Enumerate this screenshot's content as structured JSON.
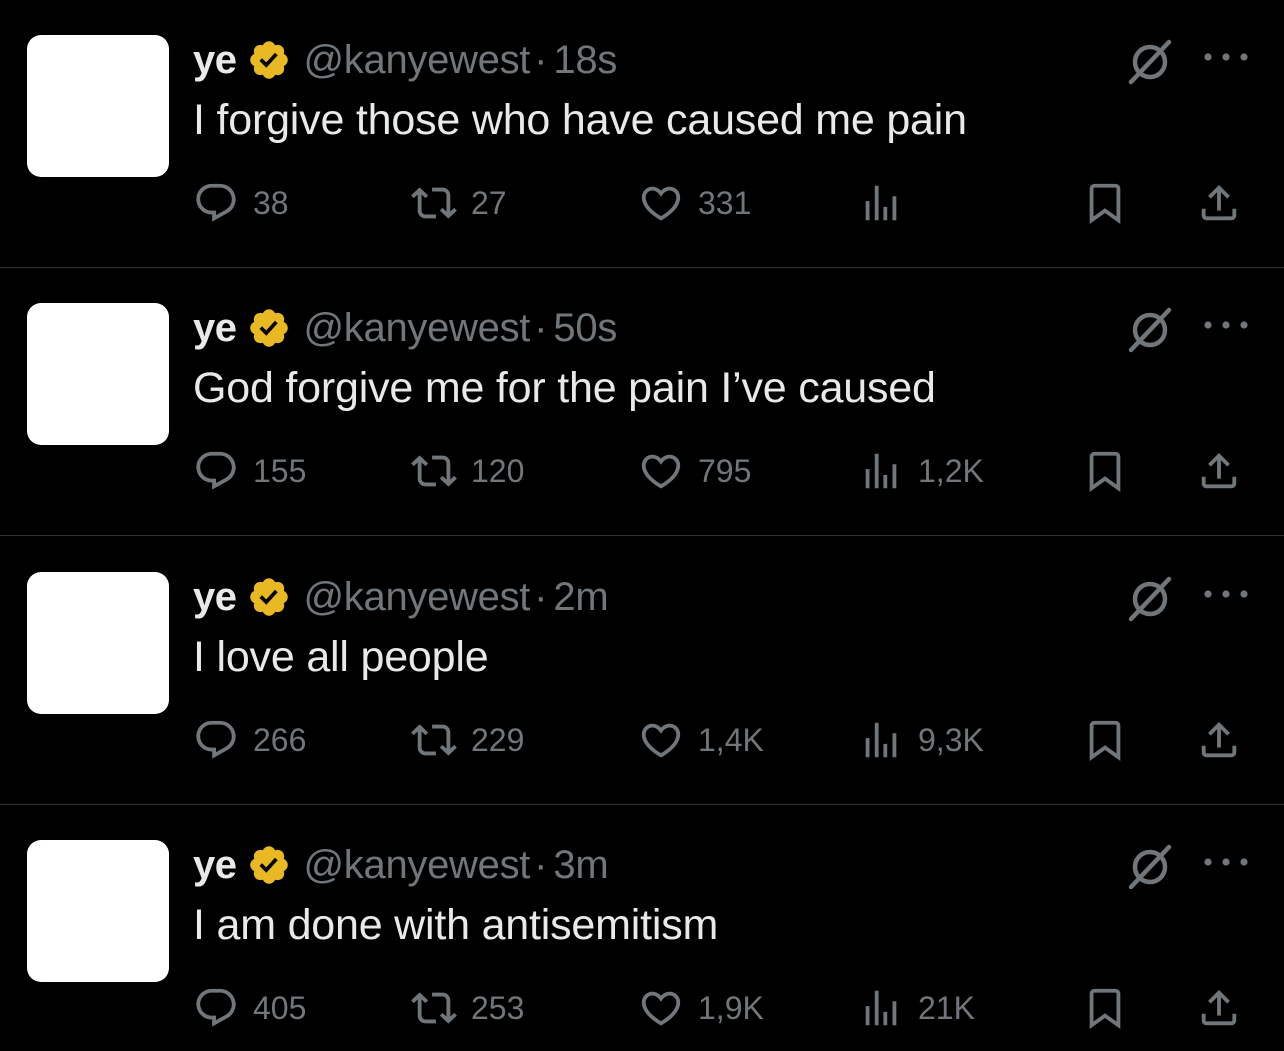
{
  "tweets": [
    {
      "name": "ye",
      "handle": "@kanyewest",
      "separator": "·",
      "time": "18s",
      "text": "I forgive those who have caused me pain",
      "replies": "38",
      "retweets": "27",
      "likes": "331",
      "views": ""
    },
    {
      "name": "ye",
      "handle": "@kanyewest",
      "separator": "·",
      "time": "50s",
      "text": "God forgive me for the pain I’ve caused",
      "replies": "155",
      "retweets": "120",
      "likes": "795",
      "views": "1,2K"
    },
    {
      "name": "ye",
      "handle": "@kanyewest",
      "separator": "·",
      "time": "2m",
      "text": "I love all people",
      "replies": "266",
      "retweets": "229",
      "likes": "1,4K",
      "views": "9,3K"
    },
    {
      "name": "ye",
      "handle": "@kanyewest",
      "separator": "·",
      "time": "3m",
      "text": "I am done with antisemitism",
      "replies": "405",
      "retweets": "253",
      "likes": "1,9K",
      "views": "21K"
    }
  ],
  "icons": {
    "verified": "verified-badge-icon",
    "grok": "grok-icon",
    "more": "more-dots-icon",
    "reply": "reply-icon",
    "retweet": "retweet-icon",
    "like": "heart-icon",
    "views": "views-chart-icon",
    "bookmark": "bookmark-icon",
    "share": "share-icon"
  },
  "colors": {
    "background": "#000000",
    "primary_text": "#e7e9ea",
    "secondary_text": "#71767b",
    "divider": "#2f3336",
    "verified_gold": "#e8b923",
    "avatar": "#ffffff"
  }
}
